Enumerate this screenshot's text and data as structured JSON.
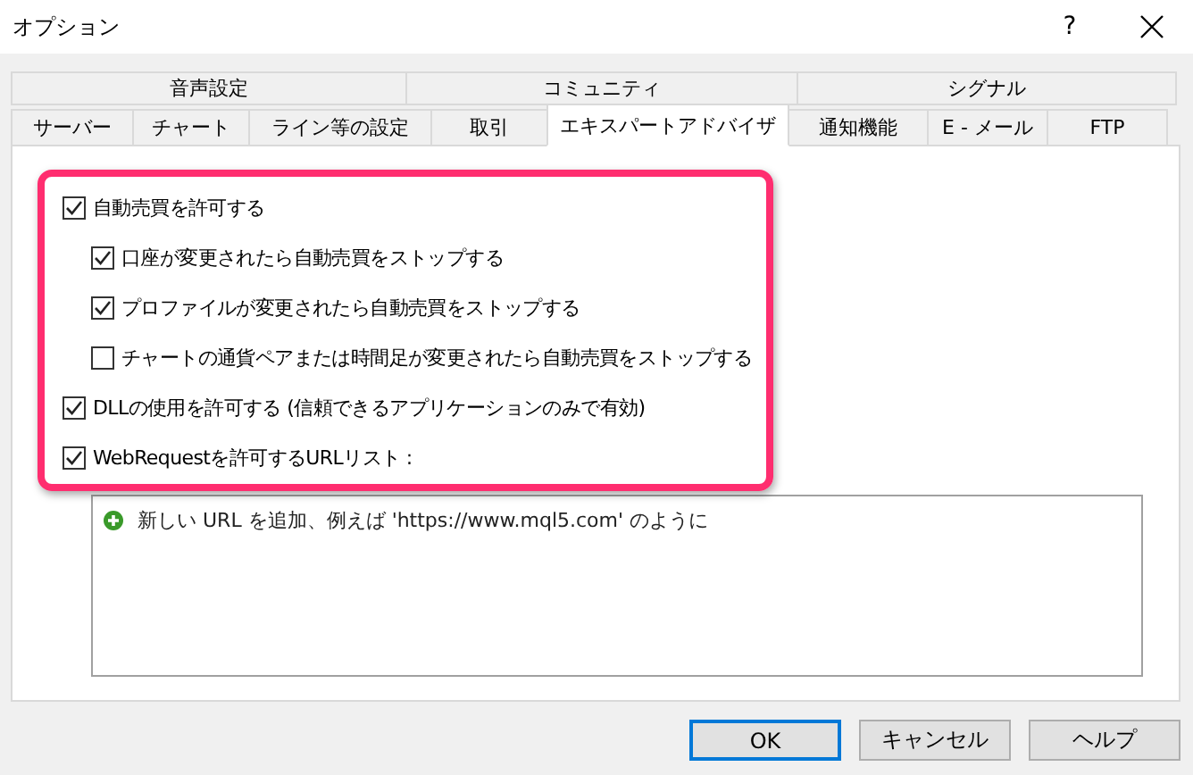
{
  "window": {
    "title": "オプション",
    "help": "?"
  },
  "tab_rows": [
    [
      {
        "label": "音声設定",
        "selected": false
      },
      {
        "label": "コミュニティ",
        "selected": false
      },
      {
        "label": "シグナル",
        "selected": false
      }
    ],
    [
      {
        "label": "サーバー",
        "selected": false
      },
      {
        "label": "チャート",
        "selected": false
      },
      {
        "label": "ライン等の設定",
        "selected": false
      },
      {
        "label": "取引",
        "selected": false
      },
      {
        "label": "エキスパートアドバイザ",
        "selected": true
      },
      {
        "label": "通知機能",
        "selected": false
      },
      {
        "label": "E - メール",
        "selected": false
      },
      {
        "label": "FTP",
        "selected": false
      }
    ]
  ],
  "options": [
    {
      "label": "自動売買を許可する",
      "checked": true,
      "children": [
        {
          "label": "口座が変更されたら自動売買をストップする",
          "checked": true
        },
        {
          "label": "プロファイルが変更されたら自動売買をストップする",
          "checked": true
        },
        {
          "label": "チャートの通貨ペアまたは時間足が変更されたら自動売買をストップする",
          "checked": false
        }
      ]
    },
    {
      "label": "DLLの使用を許可する (信頼できるアプリケーションのみで有効)",
      "checked": true
    },
    {
      "label": "WebRequestを許可するURLリスト :",
      "checked": true
    }
  ],
  "url_list": {
    "add_hint": "新しい URL を追加、例えば 'https://www.mql5.com' のように"
  },
  "buttons": [
    {
      "label": "OK",
      "default": true
    },
    {
      "label": "キャンセル",
      "default": false
    },
    {
      "label": "ヘルプ",
      "default": false
    }
  ]
}
